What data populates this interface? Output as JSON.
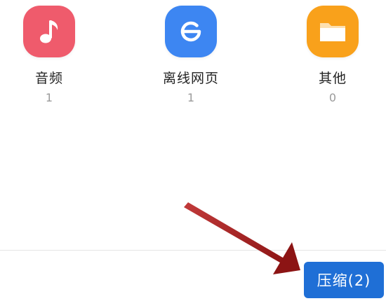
{
  "categories": [
    {
      "label": "音频",
      "count": "1",
      "icon": "music-note-icon",
      "color": "#ef5b6c"
    },
    {
      "label": "离线网页",
      "count": "1",
      "icon": "browser-e-icon",
      "color": "#3d86f2"
    },
    {
      "label": "其他",
      "count": "0",
      "icon": "folder-icon",
      "color": "#f9a11b"
    }
  ],
  "compress_button": {
    "label": "压缩(2)",
    "color": "#1f6fd6"
  },
  "annotation": {
    "arrow_color": "#9e1a1a"
  }
}
